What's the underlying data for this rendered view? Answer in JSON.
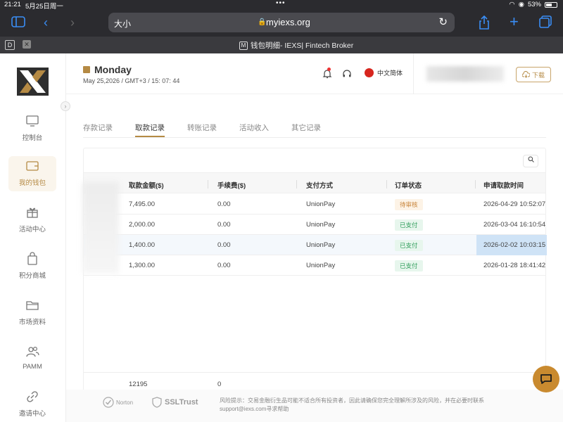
{
  "status_bar": {
    "time": "21:21",
    "date": "5月25日周一",
    "battery": "53%"
  },
  "browser": {
    "text_size": "大小",
    "host": "myiexs.org",
    "tab_title": "钱包明细- IEXS| Fintech Broker",
    "tab_icon_letter": "M",
    "tab_fav_letter": "D"
  },
  "sidebar": {
    "items": [
      {
        "label": "控制台",
        "icon": "monitor-icon"
      },
      {
        "label": "我的钱包",
        "icon": "wallet-icon",
        "active": true
      },
      {
        "label": "活动中心",
        "icon": "gift-icon"
      },
      {
        "label": "积分商城",
        "icon": "shopping-bag-icon"
      },
      {
        "label": "市场资料",
        "icon": "folder-icon"
      },
      {
        "label": "PAMM",
        "icon": "users-icon"
      },
      {
        "label": "邀请中心",
        "icon": "link-icon"
      }
    ]
  },
  "header": {
    "day": "Monday",
    "datetime": "May 25,2026 / GMT+3 / 15: 07: 44",
    "language": "中文简体",
    "download_label": "下载"
  },
  "tabs": [
    "存款记录",
    "取款记录",
    "转账记录",
    "活动收入",
    "其它记录"
  ],
  "active_tab": "取款记录",
  "table": {
    "columns": [
      "取款金额($)",
      "手续费($)",
      "支付方式",
      "订单状态",
      "申请取款时间"
    ],
    "rows": [
      {
        "amount": "7,495.00",
        "fee": "0.00",
        "method": "UnionPay",
        "status": "待审核",
        "status_type": "pending",
        "time": "2026-04-29 10:52:07"
      },
      {
        "amount": "2,000.00",
        "fee": "0.00",
        "method": "UnionPay",
        "status": "已支付",
        "status_type": "paid",
        "time": "2026-03-04 16:10:54"
      },
      {
        "amount": "1,400.00",
        "fee": "0.00",
        "method": "UnionPay",
        "status": "已支付",
        "status_type": "paid",
        "time": "2026-02-02 10:03:15"
      },
      {
        "amount": "1,300.00",
        "fee": "0.00",
        "method": "UnionPay",
        "status": "已支付",
        "status_type": "paid",
        "time": "2026-01-28 18:41:42"
      }
    ],
    "total_amount": "12195",
    "total_fee": "0"
  },
  "footer": {
    "norton": "Norton",
    "ssl": "SSLTrust",
    "risk_line1": "风险提示：交易金融衍生品可能不适合所有投资者，因此请确保您完全理解所涉及的风险，并在必要时联系",
    "risk_line2": "support@iexs.com寻求帮助"
  },
  "colors": {
    "accent": "#b58a44",
    "paid": "#2f9d5a",
    "pending": "#c8843a",
    "chat": "#c98a2f"
  }
}
